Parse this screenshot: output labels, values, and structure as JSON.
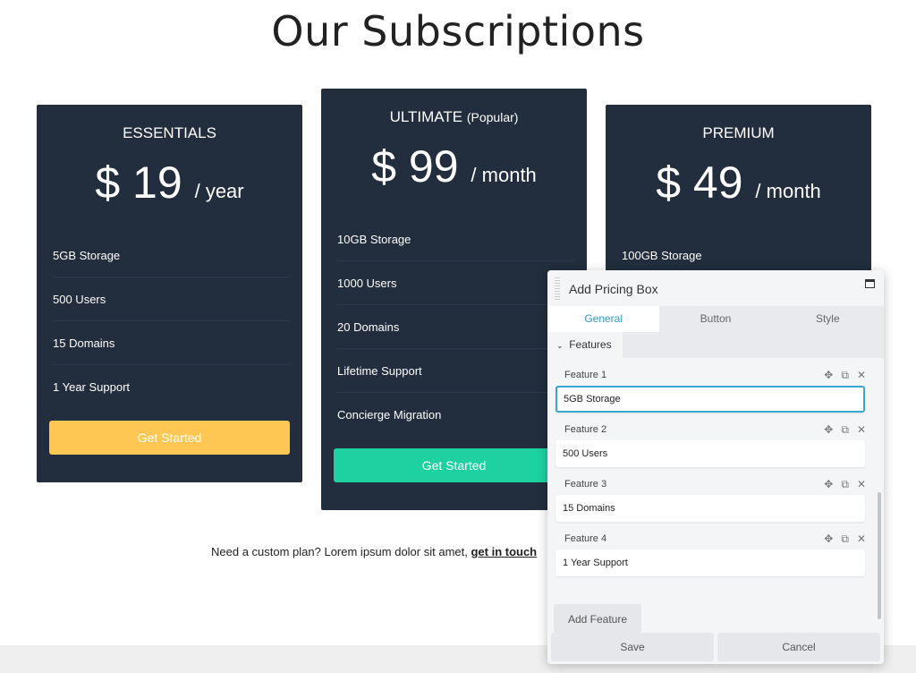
{
  "page": {
    "title": "Our Subscriptions"
  },
  "plans": [
    {
      "name": "ESSENTIALS",
      "tag": "",
      "price": "$ 19",
      "period": "/ year",
      "features": [
        "5GB Storage",
        "500 Users",
        "15 Domains",
        "1 Year Support"
      ],
      "button": "Get Started",
      "button_color": "#fec652"
    },
    {
      "name": "ULTIMATE",
      "tag": "(Popular)",
      "price": "$ 99",
      "period": "/ month",
      "features": [
        "10GB Storage",
        "1000 Users",
        "20 Domains",
        "Lifetime Support",
        "Concierge Migration"
      ],
      "button": "Get Started",
      "button_color": "#1dd1a1"
    },
    {
      "name": "PREMIUM",
      "tag": "",
      "price": "$ 49",
      "period": "/ month",
      "features": [
        "100GB Storage"
      ],
      "button": "",
      "button_color": ""
    }
  ],
  "custom": {
    "text": "Need a custom plan? Lorem ipsum dolor sit amet, ",
    "link": "get in touch"
  },
  "panel": {
    "title": "Add Pricing Box",
    "tabs": [
      "General",
      "Button",
      "Style"
    ],
    "section": "Features",
    "features": [
      {
        "label": "Feature 1",
        "value": "5GB Storage"
      },
      {
        "label": "Feature 2",
        "value": "500 Users"
      },
      {
        "label": "Feature 3",
        "value": "15 Domains"
      },
      {
        "label": "Feature 4",
        "value": "1 Year Support"
      }
    ],
    "add_feature": "Add Feature",
    "save": "Save",
    "cancel": "Cancel"
  }
}
